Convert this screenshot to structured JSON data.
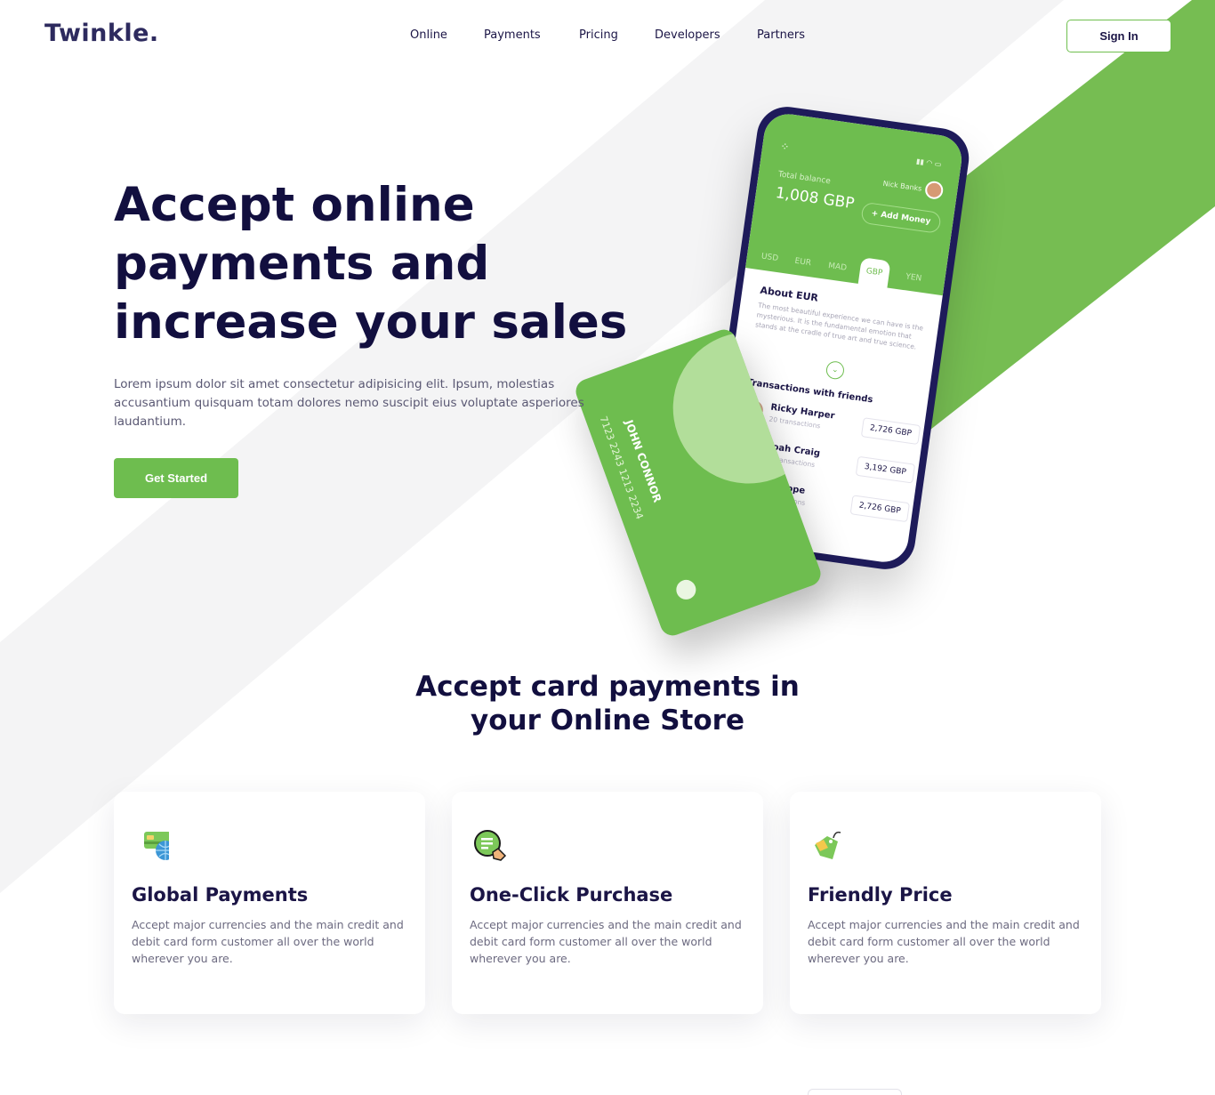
{
  "header": {
    "logo": "Twinkle.",
    "nav": [
      "Online",
      "Payments",
      "Pricing",
      "Developers",
      "Partners"
    ],
    "signin_label": "Sign In"
  },
  "hero": {
    "title_lines": [
      "Accept online",
      "payments and",
      "increase your sales"
    ],
    "text": "Lorem ipsum dolor sit amet consectetur adipisicing elit. Ipsum, molestias accusantium quisquam totam dolores nemo suscipit eius voluptate asperiores laudantium.",
    "cta_label": "Get Started"
  },
  "phone": {
    "balance_label": "Total balance",
    "balance": "1,008 GBP",
    "user": "Nick Banks",
    "add_money": "+ Add Money",
    "tabs": [
      "USD",
      "EUR",
      "MAD",
      "GBP",
      "YEN"
    ],
    "active_tab": "GBP",
    "about_title": "About EUR",
    "about_text": "The most beautiful experience we can have is the mysterious. It is the fundamental emotion that stands at the cradle of true art and true science.",
    "transactions_title": "Transactions with friends",
    "transactions": [
      {
        "name": "Ricky Harper",
        "sub": "20 transactions",
        "amount": "2,726 GBP"
      },
      {
        "name": "Noah Craig",
        "sub": "12 transactions",
        "amount": "3,192 GBP"
      },
      {
        "name": "Lily Pope",
        "sub": "9 transactions",
        "amount": "2,726 GBP"
      }
    ]
  },
  "credit_card": {
    "holder": "JOHN CONNOR",
    "number": "7123  2243  1213  2234"
  },
  "features": {
    "title_lines": [
      "Accept card payments in",
      "your Online Store"
    ],
    "items": [
      {
        "icon": "card-globe-icon",
        "title": "Global Payments",
        "text": "Accept major currencies and the main credit and debit card form customer all over the world wherever you are."
      },
      {
        "icon": "click-purchase-icon",
        "title": "One-Click Purchase",
        "text": "Accept major currencies and the main credit and debit card form customer all over the world wherever you are."
      },
      {
        "icon": "price-tag-icon",
        "title": "Friendly Price",
        "text": "Accept major currencies and the main credit and debit card form customer all over the world wherever you are."
      }
    ]
  },
  "colors": {
    "brand_green": "#6ebd4f",
    "navy": "#120f3f",
    "stripe_gray": "#f4f4f5"
  }
}
